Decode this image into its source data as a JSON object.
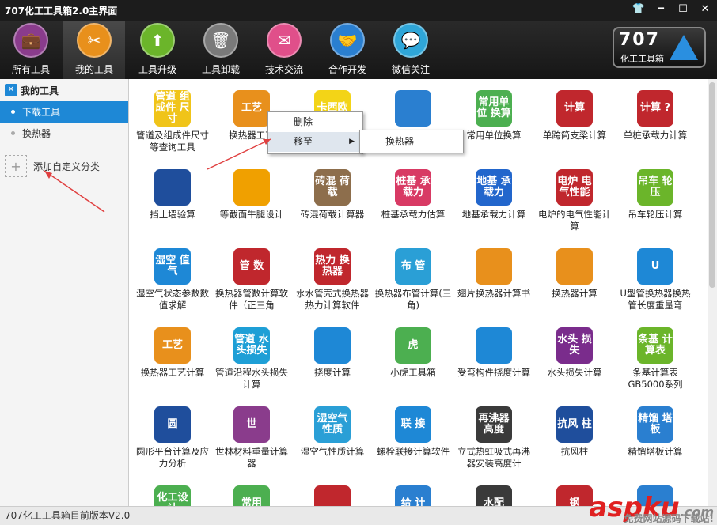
{
  "window": {
    "title": "707化工工具箱2.0主界面",
    "buttons": [
      "shirt-icon",
      "minimize-icon",
      "maximize-icon",
      "close-icon"
    ]
  },
  "toolbar": {
    "items": [
      {
        "label": "所有工具",
        "icon": "briefcase-icon",
        "color": "#8a3c8c"
      },
      {
        "label": "我的工具",
        "icon": "tools-icon",
        "color": "#e8901c"
      },
      {
        "label": "工具升级",
        "icon": "upload-icon",
        "color": "#6bb52a"
      },
      {
        "label": "工具卸载",
        "icon": "trash-icon",
        "color": "#7a7a7a"
      },
      {
        "label": "技术交流",
        "icon": "mail-icon",
        "color": "#e04f8a"
      },
      {
        "label": "合作开发",
        "icon": "handshake-icon",
        "color": "#2a7fd0"
      },
      {
        "label": "微信关注",
        "icon": "wechat-icon",
        "color": "#2fa6d8"
      }
    ],
    "logo": {
      "number": "707",
      "name": "化工工具箱"
    }
  },
  "sidebar": {
    "header": "我的工具",
    "items": [
      {
        "label": "下载工具",
        "selected": true
      },
      {
        "label": "换热器",
        "selected": false
      }
    ],
    "add_label": "添加自定义分类"
  },
  "context_menu": {
    "items": [
      "删除",
      "移至"
    ],
    "submenu": [
      "换热器"
    ]
  },
  "tools": [
    {
      "label": "管道及组成件尺寸等查询工具",
      "icon_text": "管道 组成件 尺寸",
      "color": "#f0c419"
    },
    {
      "label": "换热器工艺",
      "icon_text": "工艺",
      "color": "#e8901c"
    },
    {
      "label": "",
      "icon_text": "卡西欧",
      "color": "#f3d417"
    },
    {
      "label": "",
      "icon_text": "",
      "color": "#2a7fd0"
    },
    {
      "label": "常用单位换算",
      "icon_text": "常用单位 换算",
      "color": "#4caf50"
    },
    {
      "label": "单跨简支梁计算",
      "icon_text": "计算",
      "color": "#c0272d"
    },
    {
      "label": "单桩承载力计算",
      "icon_text": "计算 ?",
      "color": "#c0272d"
    },
    {
      "label": "挡土墙验算",
      "icon_text": "",
      "color": "#1f4e9c"
    },
    {
      "label": "等截面牛腿设计",
      "icon_text": "",
      "color": "#f0a000"
    },
    {
      "label": "砖混荷载计算器",
      "icon_text": "砖混 荷载",
      "color": "#8d6e4c"
    },
    {
      "label": "桩基承载力估算",
      "icon_text": "桩基 承载力",
      "color": "#d83a64"
    },
    {
      "label": "地基承载力计算",
      "icon_text": "地基 承载力",
      "color": "#2266cc"
    },
    {
      "label": "电炉的电气性能计算",
      "icon_text": "电炉 电气性能",
      "color": "#c0272d"
    },
    {
      "label": "吊车轮压计算",
      "icon_text": "吊车 轮压",
      "color": "#6bb52a"
    },
    {
      "label": "湿空气状态参数数值求解",
      "icon_text": "湿空 值气",
      "color": "#1e88d6"
    },
    {
      "label": "换热器管数计算软件（正三角",
      "icon_text": "管 数",
      "color": "#c0272d"
    },
    {
      "label": "水水管壳式换热器热力计算软件",
      "icon_text": "热力 换热器",
      "color": "#c0272d"
    },
    {
      "label": "换热器布管计算(三角)",
      "icon_text": "布 管",
      "color": "#2a9fd6"
    },
    {
      "label": "翅片换热器计算书",
      "icon_text": "",
      "color": "#e8901c"
    },
    {
      "label": "换热器计算",
      "icon_text": "",
      "color": "#e8901c"
    },
    {
      "label": "U型管换热器换热管长度重量弯",
      "icon_text": "U",
      "color": "#1e88d6"
    },
    {
      "label": "换热器工艺计算",
      "icon_text": "工艺",
      "color": "#e8901c"
    },
    {
      "label": "管道沿程水头损失计算",
      "icon_text": "管道 水头损失",
      "color": "#1e9fd6"
    },
    {
      "label": "挠度计算",
      "icon_text": "",
      "color": "#1e88d6"
    },
    {
      "label": "小虎工具箱",
      "icon_text": "虎",
      "color": "#4caf50"
    },
    {
      "label": "受弯构件挠度计算",
      "icon_text": "",
      "color": "#1e88d6"
    },
    {
      "label": "水头损失计算",
      "icon_text": "水头 损失",
      "color": "#7a2c8c"
    },
    {
      "label": "条基计算表GB5000系列",
      "icon_text": "条基 计算表",
      "color": "#6bb52a"
    },
    {
      "label": "圆形平台计算及应力分析",
      "icon_text": "圆",
      "color": "#1f4e9c"
    },
    {
      "label": "世林材料重量计算器",
      "icon_text": "世",
      "color": "#8a3c8c"
    },
    {
      "label": "湿空气性质计算",
      "icon_text": "湿空气 性质",
      "color": "#2a9fd6"
    },
    {
      "label": "螺栓联接计算软件",
      "icon_text": "联 接",
      "color": "#1e88d6"
    },
    {
      "label": "立式热虹吸式再沸器安装高度计",
      "icon_text": "再沸器 高度",
      "color": "#3a3a3a"
    },
    {
      "label": "抗风柱",
      "icon_text": "抗风 柱",
      "color": "#1f4e9c"
    },
    {
      "label": "精馏塔板计算",
      "icon_text": "精馏 塔板",
      "color": "#2a7fd0"
    },
    {
      "label": "",
      "icon_text": "化工设计",
      "color": "#4caf50"
    },
    {
      "label": "",
      "icon_text": "常用",
      "color": "#4caf50"
    },
    {
      "label": "",
      "icon_text": "",
      "color": "#c0272d"
    },
    {
      "label": "",
      "icon_text": "给 计",
      "color": "#2a7fd0"
    },
    {
      "label": "",
      "icon_text": "水配",
      "color": "#3a3a3a"
    },
    {
      "label": "",
      "icon_text": "钢",
      "color": "#c0272d"
    },
    {
      "label": "",
      "icon_text": "",
      "color": "#2a7fd0"
    }
  ],
  "status": {
    "version_text": "707化工工具箱目前版本V2.0"
  },
  "watermark": {
    "text": "aspku",
    "suffix": ".com",
    "sub": "免费网站源码下载站!"
  }
}
